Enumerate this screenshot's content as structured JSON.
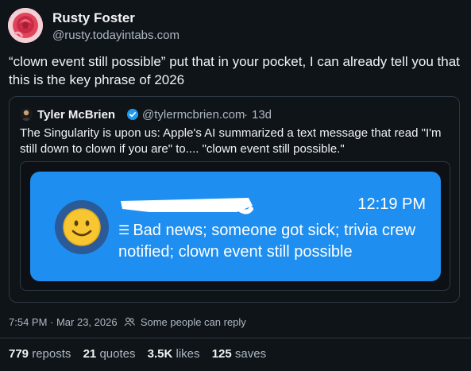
{
  "author": {
    "display_name": "Rusty Foster",
    "handle": "@rusty.todayintabs.com",
    "avatar_icon": "rose-icon"
  },
  "post": {
    "text": "“clown event still possible” put that in your pocket, I can already tell you that this is the key phrase of 2026"
  },
  "quote": {
    "display_name": "Tyler McBrien",
    "handle": "@tylermcbrien.com",
    "separator": "·",
    "time": "13d",
    "verified": true,
    "text": "The Singularity is upon us: Apple's AI summarized a text message that read \"I'm still down to clown if you are\" to.... \"clown event still possible.\"",
    "image": {
      "notification_time": "12:19 PM",
      "summary_icon": "summary-icon",
      "summary_text": "Bad news; someone got sick; trivia crew notified; clown event still possible",
      "emoji_icon": "smiley-emoji-icon"
    }
  },
  "meta": {
    "timestamp": "7:54 PM · Mar 23, 2026",
    "separator": "·",
    "reply_setting": "Some people can reply"
  },
  "stats": {
    "reposts_count": "779",
    "reposts_label": "reposts",
    "quotes_count": "21",
    "quotes_label": "quotes",
    "likes_count": "3.5K",
    "likes_label": "likes",
    "saves_count": "125",
    "saves_label": "saves"
  },
  "colors": {
    "background": "#0f1419",
    "notification_blue": "#1e8ef0",
    "verified_blue": "#1d9bf0"
  }
}
